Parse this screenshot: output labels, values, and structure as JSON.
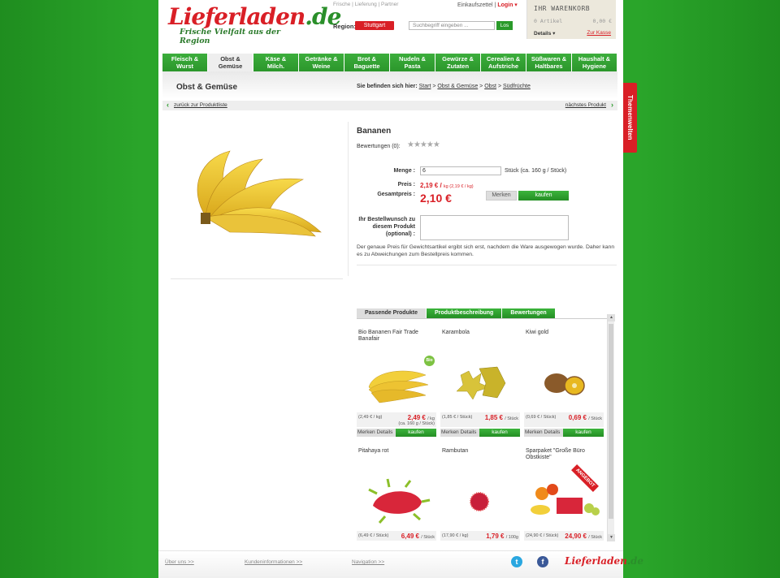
{
  "header": {
    "logo_main": "Lieferladen",
    "logo_tld": ".de",
    "logo_tagline": "Frische Vielfalt aus der Region",
    "top_links": [
      "Frische",
      "Lieferung",
      "Partner"
    ],
    "wishlist_label": "Einkaufszettel",
    "login_label": "Login ▾",
    "region_label": "Region:",
    "region_value": "Stuttgart",
    "search_placeholder": "Suchbegriff eingeben ...",
    "search_button": "Los"
  },
  "cart": {
    "title": "IHR WARENKORB",
    "items": "0 Artikel",
    "total": "0,00 €",
    "details_label": "Details ▾",
    "checkout_label": "Zur Kasse"
  },
  "nav": {
    "items": [
      {
        "line1": "Fleisch &",
        "line2": "Wurst"
      },
      {
        "line1": "Obst &",
        "line2": "Gemüse"
      },
      {
        "line1": "Käse &",
        "line2": "Milch."
      },
      {
        "line1": "Getränke &",
        "line2": "Weine"
      },
      {
        "line1": "Brot &",
        "line2": "Baguette"
      },
      {
        "line1": "Nudeln &",
        "line2": "Pasta"
      },
      {
        "line1": "Gewürze &",
        "line2": "Zutaten"
      },
      {
        "line1": "Cerealien &",
        "line2": "Aufstriche"
      },
      {
        "line1": "Süßwaren &",
        "line2": "Haltbares"
      },
      {
        "line1": "Haushalt &",
        "line2": "Hygiene"
      }
    ]
  },
  "section": {
    "title": "Obst & Gemüse",
    "breadcrumb_label": "Sie befinden sich hier:",
    "breadcrumb": [
      "Start",
      "Obst & Gemüse",
      "Obst",
      "Südfrüchte"
    ],
    "back_link": "zurück zur Produktliste",
    "next_link": "nächstes Produkt"
  },
  "product": {
    "name": "Bananen",
    "rating_label": "Bewertungen (0):",
    "stars": "★★★★★",
    "qty_label": "Menge :",
    "qty_value": "6",
    "qty_unit": "Stück (ca. 160 g / Stück)",
    "price_label": "Preis :",
    "price_value": "2,19 € /",
    "price_unit": "kg (2,19 € / kg)",
    "total_label": "Gesamtpreis :",
    "total_value": "2,10 €",
    "merken_label": "Merken",
    "buy_label": "kaufen",
    "wish_label_1": "Ihr Bestellwunsch zu",
    "wish_label_2": "diesem Produkt",
    "wish_label_3": "(optional) :",
    "note": "Der genaue Preis für Gewichtsartikel ergibt sich erst, nachdem die Ware ausgewogen wurde. Daher kann es zu Abweichungen zum Bestellpreis kommen."
  },
  "tabs": [
    "Passende Produkte",
    "Produktbeschreibung",
    "Bewertungen"
  ],
  "related": [
    {
      "name": "Bio Bananen Fair Trade Banafair",
      "unit_price": "(2,49 € / kg)",
      "price": "2,49 €",
      "price_unit": "/ kg",
      "sub": "(ca. 160 g / Stück)",
      "bio": "Bio",
      "merken": "Merken",
      "details": "Details",
      "buy": "kaufen"
    },
    {
      "name": "Karambola",
      "unit_price": "(1,85 € / Stück)",
      "price": "1,85 €",
      "price_unit": "/ Stück",
      "sub": "",
      "merken": "Merken",
      "details": "Details",
      "buy": "kaufen"
    },
    {
      "name": "Kiwi gold",
      "unit_price": "(0,69 € / Stück)",
      "price": "0,69 €",
      "price_unit": "/ Stück",
      "sub": "",
      "merken": "Merken",
      "details": "Details",
      "buy": "kaufen"
    },
    {
      "name": "Pitahaya rot",
      "unit_price": "(6,49 € / Stück)",
      "price": "6,49 €",
      "price_unit": "/ Stück",
      "sub": ""
    },
    {
      "name": "Rambutan",
      "unit_price": "(17,90 € / kg)",
      "price": "1,79 €",
      "price_unit": "/ 100g",
      "sub": ""
    },
    {
      "name": "Sparpaket \"Große Büro Obstkiste\"",
      "unit_price": "(24,90 € / Stück)",
      "price": "24,90 €",
      "price_unit": "/ Stück",
      "sub": "",
      "badge": "ANGEBOT"
    }
  ],
  "footer": {
    "about": "Über uns >>",
    "customer_info": "Kundeninformationen >>",
    "navigation": "Navigation >>"
  },
  "side_tab": "Themenwelten",
  "colors": {
    "brand_red": "#d91f26",
    "brand_green": "#2a9a2a",
    "background_green": "#2aa52a"
  }
}
